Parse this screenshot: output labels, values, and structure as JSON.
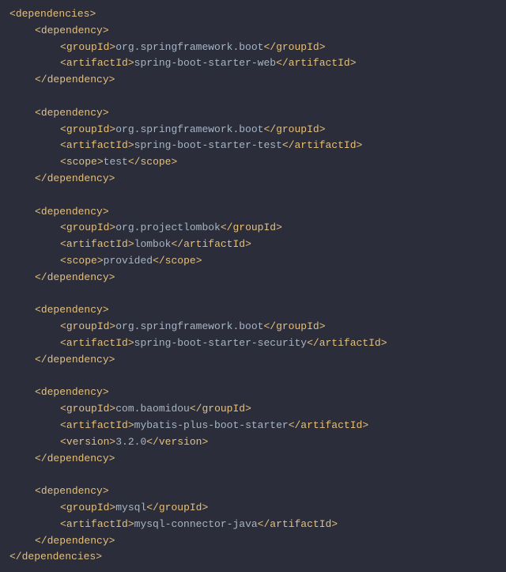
{
  "tags": {
    "dependencies_open": "dependencies",
    "dependencies_close": "dependencies",
    "dependency_open": "dependency",
    "dependency_close": "dependency",
    "groupId": "groupId",
    "artifactId": "artifactId",
    "scope": "scope",
    "version": "version"
  },
  "deps": [
    {
      "groupId": "org.springframework.boot",
      "artifactId": "spring-boot-starter-web"
    },
    {
      "groupId": "org.springframework.boot",
      "artifactId": "spring-boot-starter-test",
      "scope": "test"
    },
    {
      "groupId": "org.projectlombok",
      "artifactId": "lombok",
      "scope": "provided"
    },
    {
      "groupId": "org.springframework.boot",
      "artifactId": "spring-boot-starter-security"
    },
    {
      "groupId": "com.baomidou",
      "artifactId": "mybatis-plus-boot-starter",
      "version": "3.2.0"
    },
    {
      "groupId": "mysql",
      "artifactId": "mysql-connector-java"
    }
  ]
}
